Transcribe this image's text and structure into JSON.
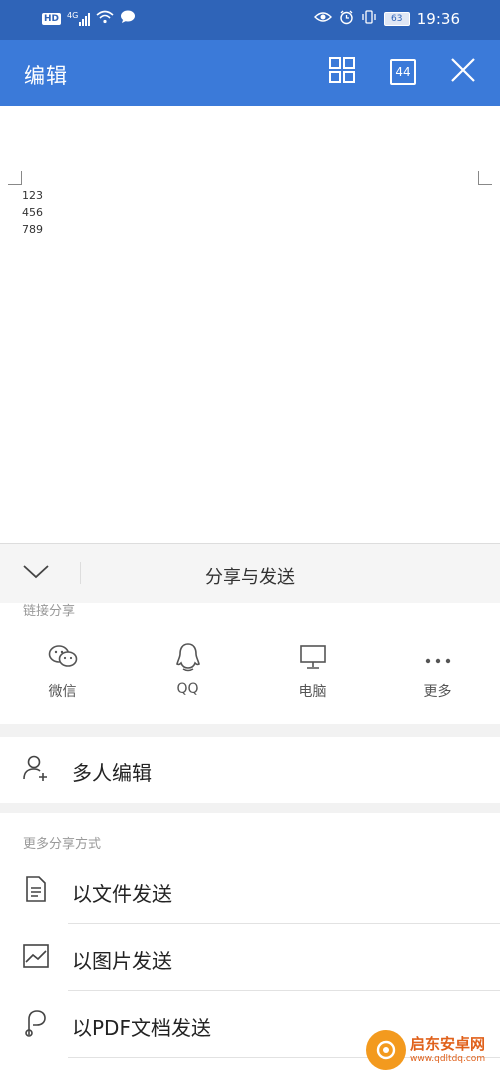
{
  "status_bar": {
    "hd_label": "HD",
    "network_label": "4G",
    "battery": "63",
    "time": "19:36"
  },
  "header": {
    "title": "编辑",
    "pages_count": "44"
  },
  "document": {
    "lines": [
      "123",
      "456",
      "789"
    ]
  },
  "panel": {
    "title": "分享与发送"
  },
  "link_share": {
    "label": "链接分享",
    "items": [
      {
        "label": "微信",
        "icon": "wechat-icon"
      },
      {
        "label": "QQ",
        "icon": "qq-icon"
      },
      {
        "label": "电脑",
        "icon": "monitor-icon"
      },
      {
        "label": "更多",
        "icon": "more-icon"
      }
    ]
  },
  "multi_edit": {
    "label": "多人编辑"
  },
  "more_share": {
    "label": "更多分享方式",
    "items": [
      {
        "label": "以文件发送",
        "icon": "file-icon"
      },
      {
        "label": "以图片发送",
        "icon": "image-icon"
      },
      {
        "label": "以PDF文档发送",
        "icon": "pdf-icon"
      }
    ]
  },
  "watermark": {
    "name": "启东安卓网",
    "url": "www.qdltdq.com"
  },
  "colors": {
    "status_bar": "#2f64b8",
    "app_bar": "#3b7ad9",
    "watermark": "#e0611b"
  }
}
